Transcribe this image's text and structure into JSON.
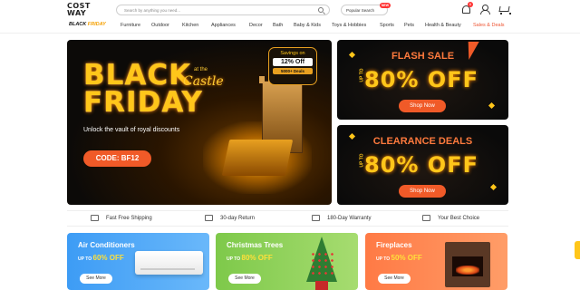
{
  "header": {
    "logo_line1": "COST",
    "logo_line2": "WAY",
    "search_placeholder": "Search by anything you need...",
    "popular_search": "Popular Search",
    "new_badge": "NEW",
    "notification_count": "6"
  },
  "nav": {
    "black_friday_logo_a": "BLACK ",
    "black_friday_logo_b": "FRIDAY",
    "items": [
      "Furniture",
      "Outdoor",
      "Kitchen",
      "Appliances",
      "Decor",
      "Bath",
      "Baby & Kids",
      "Toys & Hobbies",
      "Sports",
      "Pets",
      "Health & Beauty",
      "Sales & Deals"
    ]
  },
  "hero": {
    "title": "BLACK FRIDAY",
    "title_line1": "BLACK",
    "title_line2": "FRIDAY",
    "at_the": "at the",
    "castle": "Castle",
    "subtitle": "Unlock the vault of royal discounts",
    "code": "CODE: BF12",
    "savings_label": "Savings on",
    "savings_value": "12% Off",
    "savings_deals": "5000+ Deals"
  },
  "flash_sale": {
    "title": "FLASH SALE",
    "up_to": "UP TO",
    "off": "80% OFF",
    "button": "Shop Now"
  },
  "clearance": {
    "title": "CLEARANCE DEALS",
    "up_to": "UP TO",
    "off": "80% OFF",
    "button": "Shop Now"
  },
  "features": [
    "Fast Free Shipping",
    "30-day Return",
    "180-Day Warranty",
    "Your Best Choice"
  ],
  "categories": [
    {
      "title": "Air Conditioners",
      "up_to": "UP TO ",
      "pct": "60% OFF",
      "button": "See More"
    },
    {
      "title": "Christmas Trees",
      "up_to": "UP TO ",
      "pct": "80% OFF",
      "button": "See More"
    },
    {
      "title": "Fireplaces",
      "up_to": "UP TO ",
      "pct": "50% OFF",
      "button": "See More"
    }
  ],
  "colors": {
    "accent": "#f05a28",
    "gold": "#ffc61a",
    "sale_red": "#e53"
  }
}
